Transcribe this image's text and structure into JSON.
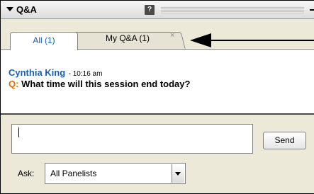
{
  "panel": {
    "title": "Q&A",
    "help_icon": "?"
  },
  "tabs": [
    {
      "label": "All (1)",
      "active": true
    },
    {
      "label": "My Q&A (1)",
      "active": false,
      "close_icon": "×"
    }
  ],
  "messages": [
    {
      "author": "Cynthia King",
      "time": "- 10:16 am",
      "prefix": "Q:",
      "text": "What time will this session end today?"
    }
  ],
  "composer": {
    "input_value": "",
    "send_label": "Send"
  },
  "ask": {
    "label": "Ask:",
    "selected": "All Panelists"
  },
  "colors": {
    "author": "#1a5fb4",
    "question_prefix": "#e66a00",
    "panel_bg": "#ece9d8"
  }
}
